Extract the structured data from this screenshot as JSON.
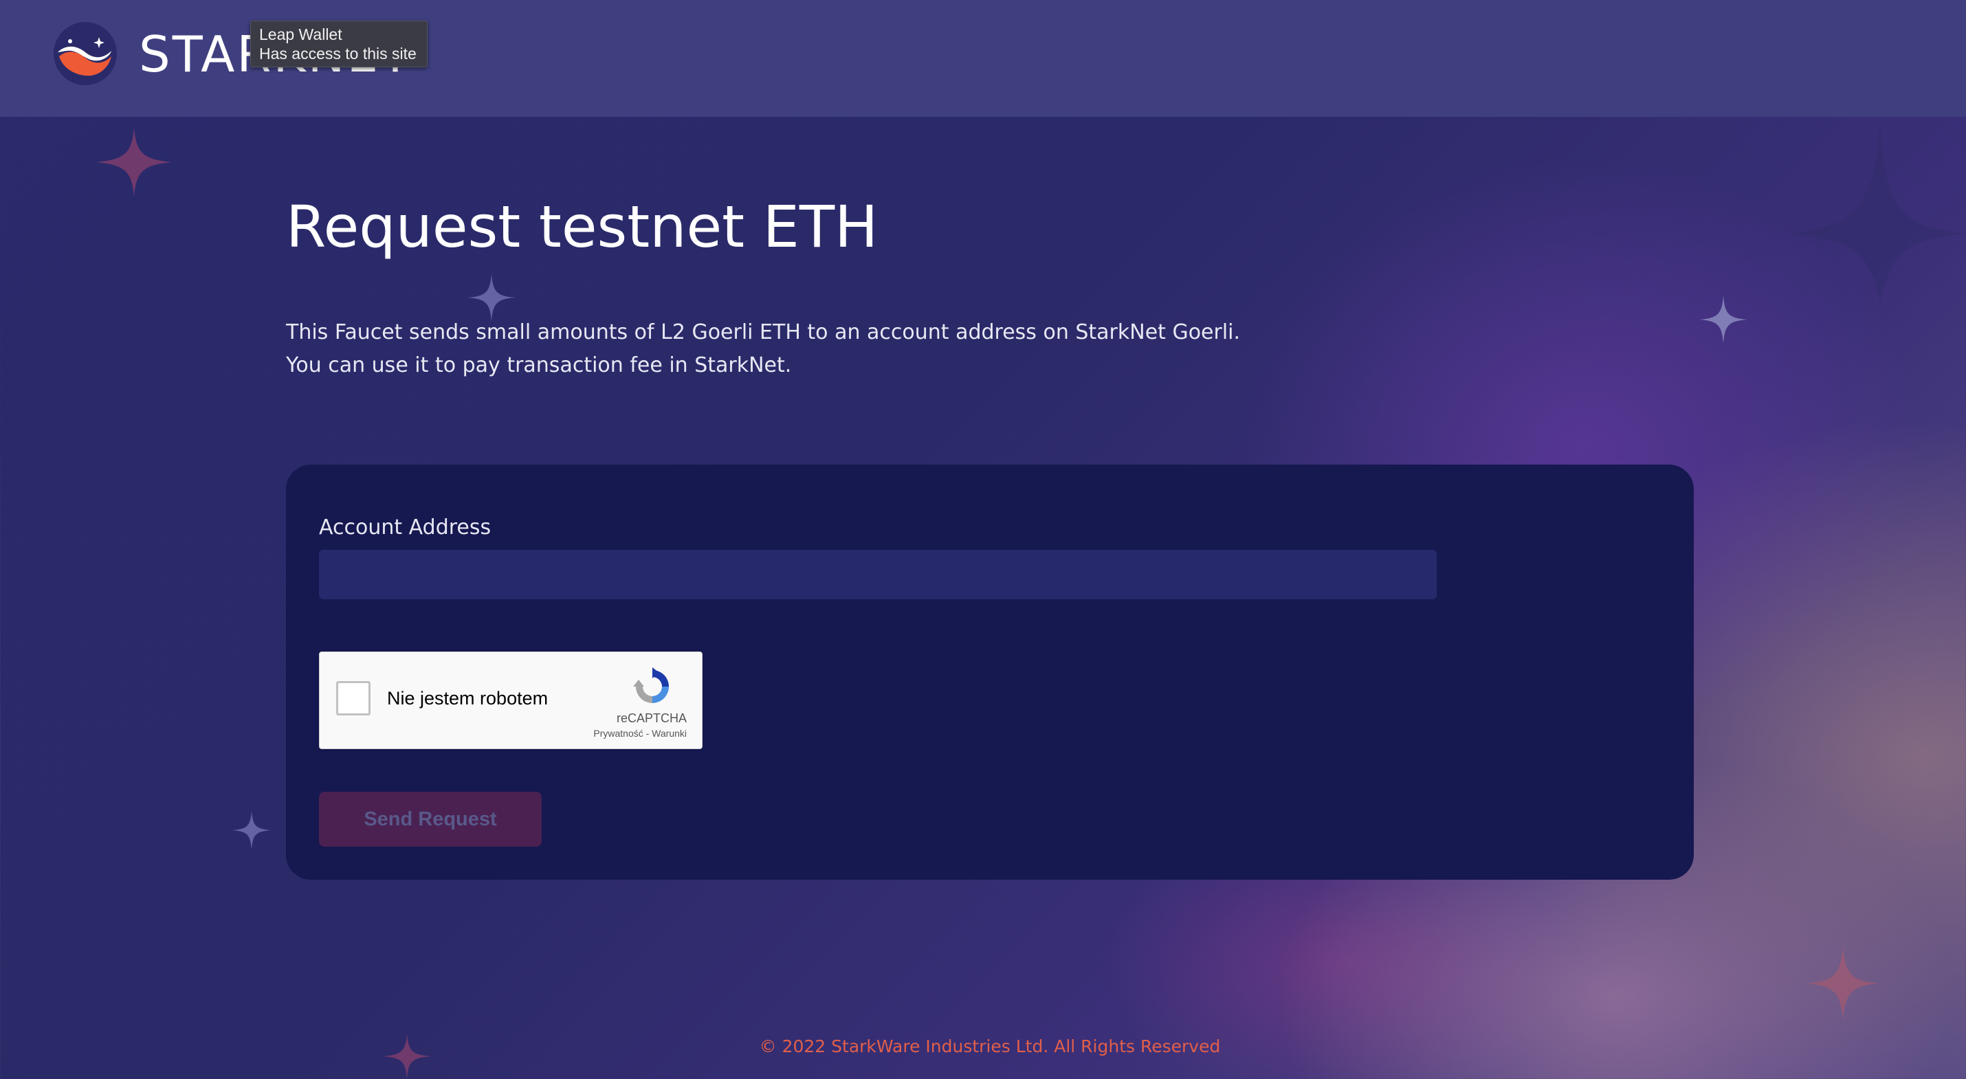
{
  "header": {
    "brand": "STARKNET"
  },
  "tooltip": {
    "title": "Leap Wallet",
    "subtitle": "Has access to this site"
  },
  "main": {
    "title": "Request testnet ETH",
    "description_line1": "This Faucet sends small amounts of L2 Goerli ETH to an account address on StarkNet Goerli.",
    "description_line2": "You can use it to pay transaction fee in StarkNet."
  },
  "form": {
    "address_label": "Account Address",
    "address_value": "",
    "captcha_label": "Nie jestem robotem",
    "captcha_brand": "reCAPTCHA",
    "captcha_links": "Prywatność - Warunki",
    "submit_label": "Send Request"
  },
  "footer": {
    "copyright": "© 2022 StarkWare Industries Ltd. All Rights Reserved"
  },
  "colors": {
    "accent": "#e05f4a",
    "card": "#161850",
    "header": "#3f3f80"
  }
}
